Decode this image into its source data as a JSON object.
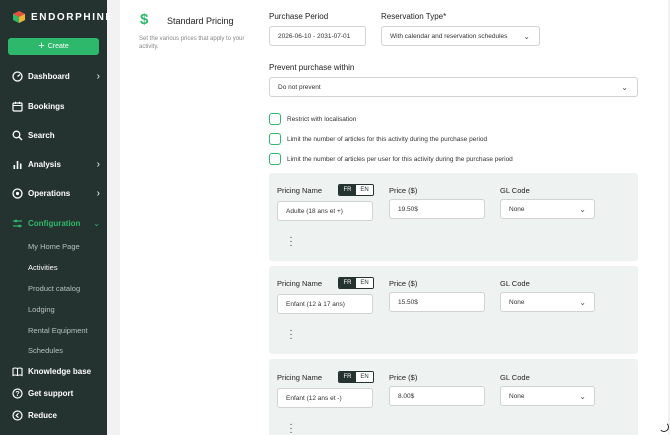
{
  "brand": {
    "name": "ENDORPHINE"
  },
  "sidebar": {
    "create_label": "Create",
    "items": [
      {
        "label": "Dashboard",
        "icon": "dashboard-icon"
      },
      {
        "label": "Bookings",
        "icon": "calendar-icon"
      },
      {
        "label": "Search",
        "icon": "search-icon"
      },
      {
        "label": "Analysis",
        "icon": "bar-chart-icon"
      },
      {
        "label": "Operations",
        "icon": "operations-icon"
      },
      {
        "label": "Configuration",
        "icon": "sliders-icon"
      }
    ],
    "sub_items": [
      "My Home Page",
      "Activities",
      "Product catalog",
      "Lodging",
      "Rental Equipment",
      "Schedules"
    ],
    "bottom": [
      {
        "label": "Knowledge base",
        "icon": "book-icon"
      },
      {
        "label": "Get support",
        "icon": "help-icon"
      },
      {
        "label": "Reduce",
        "icon": "collapse-icon"
      }
    ]
  },
  "section": {
    "title": "Standard Pricing",
    "description": "Set the various prices that apply to your activity.",
    "icon": "dollar-icon"
  },
  "form": {
    "purchase_period_label": "Purchase Period",
    "purchase_period_value": "2026-06-10 - 2031-07-01",
    "reservation_type_label": "Reservation Type*",
    "reservation_type_value": "With calendar and reservation schedules",
    "prevent_label": "Prevent purchase within",
    "prevent_value": "Do not prevent",
    "checkboxes": [
      "Restrict with localisation",
      "Limit the number of articles for this activity during the purchase period",
      "Limit the number of articles per user for this activity during the purchase period"
    ]
  },
  "pricing_labels": {
    "name": "Pricing Name",
    "price": "Price ($)",
    "gl": "GL Code",
    "lang_fr": "FR",
    "lang_en": "EN"
  },
  "pricings": [
    {
      "name": "Adulte (18 ans et +)",
      "price": "19.50$",
      "gl": "None"
    },
    {
      "name": "Enfant (12 à 17 ans)",
      "price": "15.50$",
      "gl": "None"
    },
    {
      "name": "Enfant (12 ans et -)",
      "price": "8.00$",
      "gl": "None"
    }
  ],
  "colors": {
    "sidebar_bg": "#253330",
    "accent": "#2eb86b",
    "card_bg": "#eef2f0"
  }
}
